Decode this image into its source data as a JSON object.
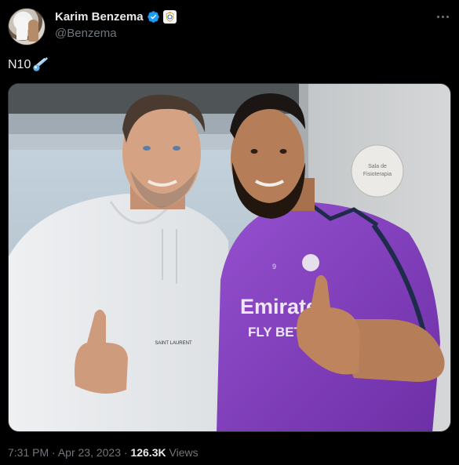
{
  "tweet": {
    "author_name": "Karim Benzema",
    "author_handle": "@Benzema",
    "text": "N10",
    "text_emoji": "comet-icon",
    "time": "7:31 PM",
    "separator": "·",
    "date": "Apr 23, 2023",
    "views_count": "126.3K",
    "views_label": "Views"
  },
  "photo": {
    "wall_sign_line1": "Sala de",
    "wall_sign_line2": "Fisioterapia",
    "jersey_brand": "Emirates",
    "jersey_brand_line2": "FLY BETTER",
    "jersey_number": "9",
    "hoodie_label": "SAINT LAURENT"
  },
  "colors": {
    "background": "#000000",
    "text_primary": "#e7e9ea",
    "text_secondary": "#71767b",
    "verified_blue": "#1d9bf0",
    "jersey_purple": "#8a43c4"
  }
}
